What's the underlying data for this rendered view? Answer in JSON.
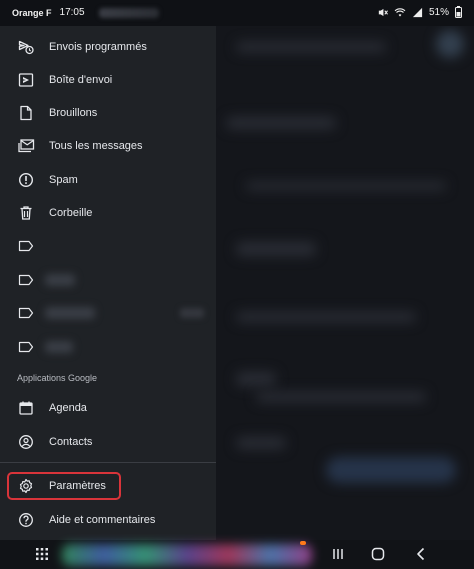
{
  "status_bar": {
    "carrier": "Orange F",
    "time": "17:05",
    "battery": "51%"
  },
  "drawer": {
    "items": [
      {
        "label": "Envois programmés",
        "icon": "scheduled-send-icon"
      },
      {
        "label": "Boîte d'envoi",
        "icon": "outbox-icon"
      },
      {
        "label": "Brouillons",
        "icon": "draft-icon"
      },
      {
        "label": "Tous les messages",
        "icon": "all-mail-icon"
      },
      {
        "label": "Spam",
        "icon": "spam-icon"
      },
      {
        "label": "Corbeille",
        "icon": "trash-icon"
      }
    ],
    "section_google": "Applications Google",
    "google_items": [
      {
        "label": "Agenda",
        "icon": "calendar-icon"
      },
      {
        "label": "Contacts",
        "icon": "contacts-icon"
      }
    ],
    "settings_label": "Paramètres",
    "help_label": "Aide et commentaires"
  },
  "colors": {
    "drawer_bg": "#1f2226",
    "highlight": "#d9343a",
    "text": "#e6e8ec"
  }
}
